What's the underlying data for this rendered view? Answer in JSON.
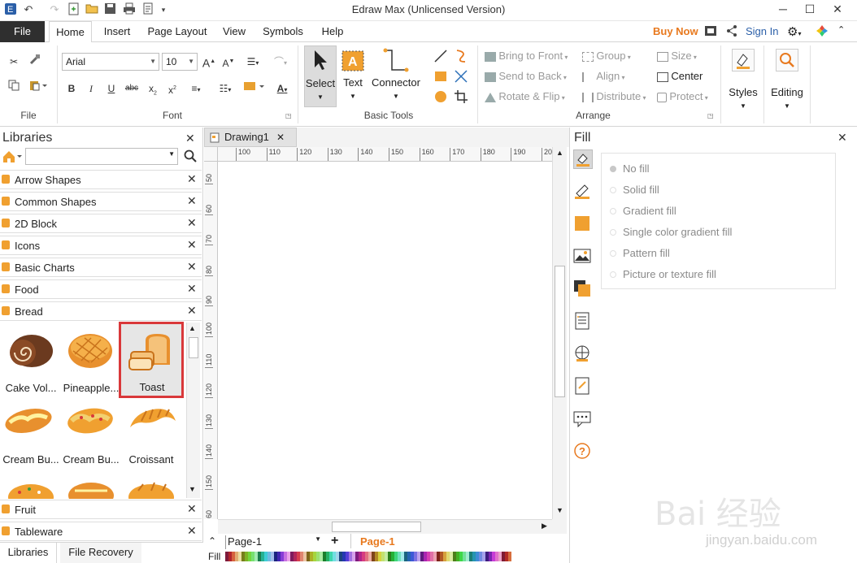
{
  "app": {
    "title": "Edraw Max (Unlicensed Version)"
  },
  "window": {
    "minimize": "─",
    "maximize": "☐",
    "close": "✕"
  },
  "menu": {
    "file": "File",
    "tabs": [
      "Home",
      "Insert",
      "Page Layout",
      "View",
      "Symbols",
      "Help"
    ],
    "active_tab": "Home",
    "buy_now": "Buy Now",
    "sign_in": "Sign In"
  },
  "ribbon": {
    "groups": {
      "file": "File",
      "font": "Font",
      "basic_tools": "Basic Tools",
      "arrange": "Arrange"
    },
    "font_name": "Arial",
    "font_size": "10",
    "select": "Select",
    "text": "Text",
    "connector": "Connector",
    "arrange": {
      "bring_to_front": "Bring to Front",
      "send_to_back": "Send to Back",
      "rotate_flip": "Rotate & Flip",
      "group": "Group",
      "align": "Align",
      "distribute": "Distribute",
      "size": "Size",
      "center": "Center",
      "protect": "Protect"
    },
    "styles": "Styles",
    "editing": "Editing"
  },
  "libraries": {
    "title": "Libraries",
    "categories": [
      "Arrow Shapes",
      "Common Shapes",
      "2D Block",
      "Icons",
      "Basic Charts",
      "Food",
      "Bread"
    ],
    "bottom_categories": [
      "Fruit",
      "Tableware"
    ],
    "shapes": [
      {
        "label": "Cake Vol..."
      },
      {
        "label": "Pineapple..."
      },
      {
        "label": "Toast"
      },
      {
        "label": "Cream Bu..."
      },
      {
        "label": "Cream Bu..."
      },
      {
        "label": "Croissant"
      }
    ],
    "bottom_tabs": [
      "Libraries",
      "File Recovery"
    ]
  },
  "document": {
    "tab": "Drawing1",
    "ruler_h": [
      "100",
      "110",
      "120",
      "130",
      "140",
      "150",
      "160",
      "170",
      "180",
      "190",
      "20"
    ],
    "ruler_v": [
      "50",
      "60",
      "70",
      "80",
      "90",
      "100",
      "110",
      "120",
      "130",
      "140",
      "150",
      "60"
    ],
    "page_select": "Page-1",
    "page_tab": "Page-1",
    "fill_label": "Fill"
  },
  "fill_panel": {
    "title": "Fill",
    "options": [
      "No fill",
      "Solid fill",
      "Gradient fill",
      "Single color gradient fill",
      "Pattern fill",
      "Picture or texture fill"
    ],
    "selected": "No fill"
  },
  "watermark": {
    "main": "Bai 经验",
    "sub": "jingyan.baidu.com"
  },
  "colors": {
    "accent": "#e8791e",
    "file_tab": "#2f2f2f",
    "star": "#f0a030",
    "selection": "#d9383a"
  }
}
